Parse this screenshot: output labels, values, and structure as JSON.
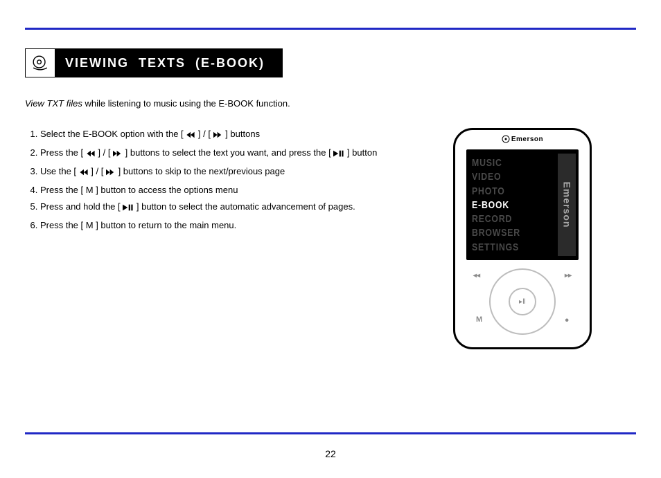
{
  "page_number": "22",
  "section": {
    "title": "VIEWING  TEXTS  (E-BOOK)"
  },
  "intro_em": "View TXT files",
  "intro_rest": " while listening to music using the E-BOOK function.",
  "steps": {
    "s1a": "Select the E-BOOK option with the [ ",
    "s1b": " ] / [ ",
    "s1c": " ]  buttons",
    "s2a": "Press the [ ",
    "s2b": " ] / [ ",
    "s2c": " ]  buttons to select the text you want, and press the",
    "s2d": " ] button",
    "s3a": "Use the [ ",
    "s3b": " ] / [ ",
    "s3c": " ]  buttons to skip to the next/previous page",
    "s4": "Press the [ M ] button to access the options menu",
    "s5a": "Press and hold the [ ",
    "s5b": " ] button to select the automatic advancement of pages.",
    "s6": "Press the [ M ] button to return to the main menu."
  },
  "device": {
    "brand_top": "Emerson",
    "side_brand": "Emerson",
    "menu": [
      "MUSIC",
      "VIDEO",
      "PHOTO",
      "E-BOOK",
      "RECORD",
      "BROWSER",
      "SETTINGS"
    ],
    "active_index": 3,
    "btn_m": "M",
    "btn_prev": "◂◂",
    "btn_next": "▸▸",
    "btn_play": "▸Ⅱ",
    "btn_dot": "•"
  },
  "icons": {
    "prev": "sym-prev",
    "next": "sym-next",
    "playpause": "sym-playpause"
  }
}
